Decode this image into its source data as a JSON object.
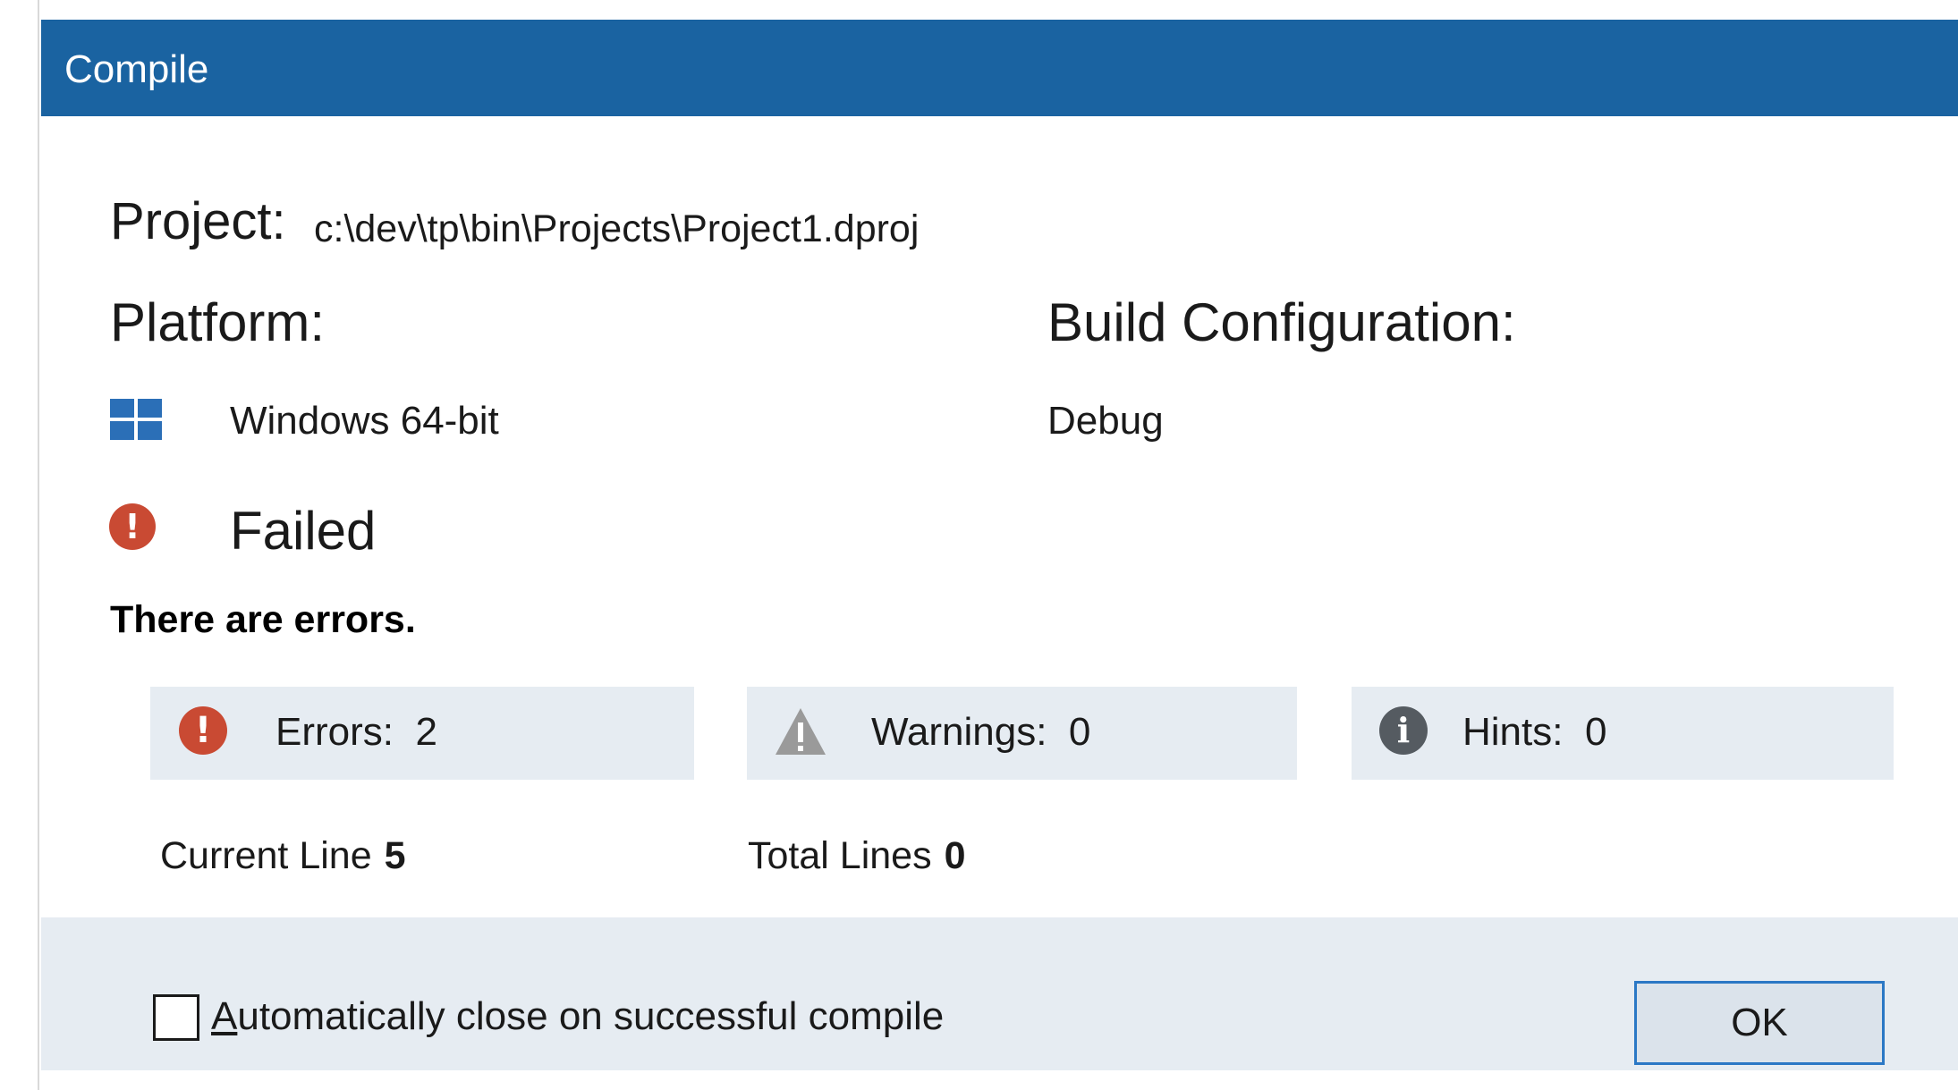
{
  "window": {
    "title": "Compile"
  },
  "project": {
    "label": "Project:",
    "path": "c:\\dev\\tp\\bin\\Projects\\Project1.dproj"
  },
  "platform": {
    "label": "Platform:",
    "value": "Windows 64-bit",
    "icon": "windows-logo-icon"
  },
  "build_configuration": {
    "label": "Build Configuration:",
    "value": "Debug"
  },
  "status": {
    "text": "Failed",
    "icon": "error-icon",
    "message": "There are errors."
  },
  "stats": {
    "errors": {
      "label": "Errors:",
      "value": "2",
      "icon": "error-icon"
    },
    "warnings": {
      "label": "Warnings:",
      "value": "0",
      "icon": "warning-icon"
    },
    "hints": {
      "label": "Hints:",
      "value": "0",
      "icon": "info-icon"
    }
  },
  "lines": {
    "current_label": "Current Line",
    "current_value": "5",
    "total_label": "Total Lines",
    "total_value": "0"
  },
  "footer": {
    "auto_close_accesskey": "A",
    "auto_close_rest": "utomatically close on successful compile",
    "auto_close_checked": false,
    "ok_label": "OK"
  },
  "colors": {
    "titlebar": "#1a63a1",
    "error": "#c94a33",
    "warning": "#9a9a9a",
    "info": "#555b61",
    "panel": "#e6ecf2",
    "accent_border": "#2b78c5",
    "windows_blue": "#2b6fb7"
  }
}
